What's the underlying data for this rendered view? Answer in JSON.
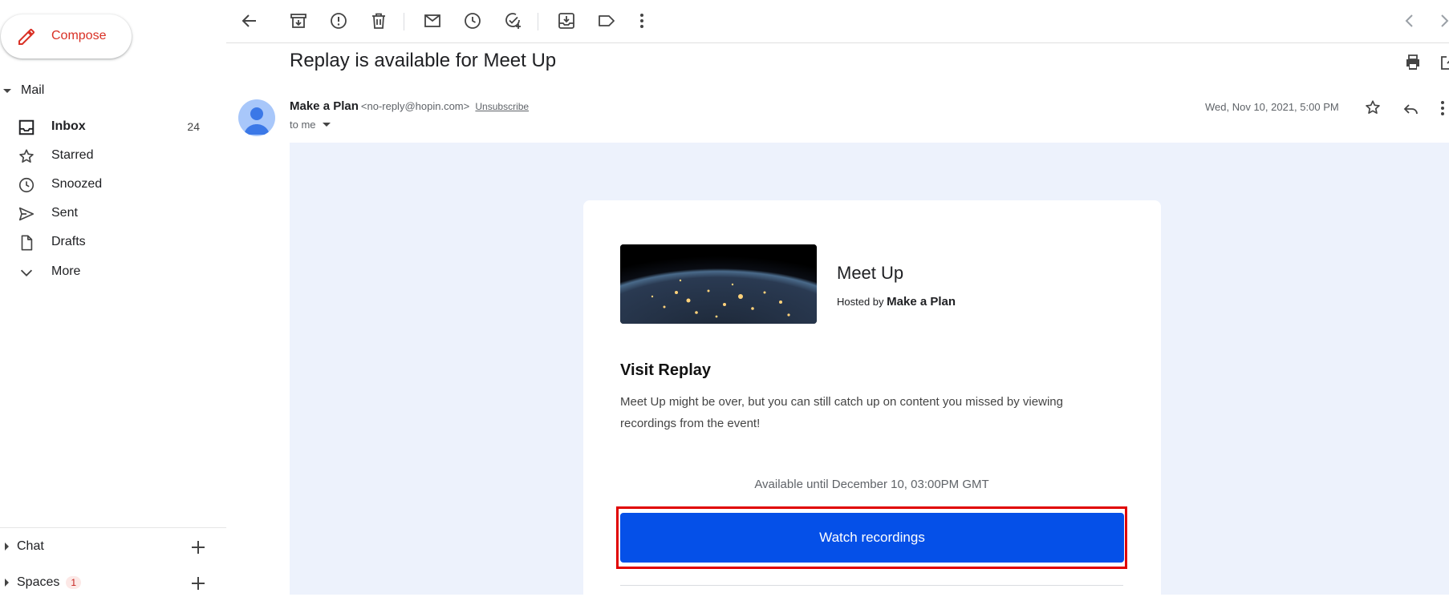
{
  "sidebar": {
    "compose_label": "Compose",
    "mail_section": "Mail",
    "items": [
      {
        "label": "Inbox",
        "count": "24",
        "icon": "inbox-icon"
      },
      {
        "label": "Starred",
        "count": "",
        "icon": "star-icon"
      },
      {
        "label": "Snoozed",
        "count": "",
        "icon": "clock-icon"
      },
      {
        "label": "Sent",
        "count": "",
        "icon": "send-icon"
      },
      {
        "label": "Drafts",
        "count": "",
        "icon": "file-icon"
      },
      {
        "label": "More",
        "count": "",
        "icon": "chevron-down-icon"
      }
    ],
    "chat_section": "Chat",
    "spaces_section": "Spaces",
    "spaces_badge": "1"
  },
  "toolbar": {
    "icons": [
      "back-arrow-icon",
      "archive-icon",
      "report-spam-icon",
      "delete-icon",
      "mark-unread-icon",
      "snooze-icon",
      "add-task-icon",
      "move-to-icon",
      "label-icon",
      "more-vert-icon"
    ]
  },
  "message": {
    "subject": "Replay is available for Meet Up",
    "sender_name": "Make a Plan",
    "sender_email": "<no-reply@hopin.com>",
    "unsubscribe": "Unsubscribe",
    "to": "to me",
    "date": "Wed, Nov 10, 2021, 5:00 PM"
  },
  "email": {
    "event_name": "Meet Up",
    "hosted_prefix": "Hosted by",
    "host": "Make a Plan",
    "replay_title": "Visit Replay",
    "replay_desc": "Meet Up might be over, but you can still catch up on content you missed by viewing recordings from the event!",
    "available": "Available until December 10, 03:00PM GMT",
    "watch_button": "Watch recordings"
  },
  "colors": {
    "compose_text": "#d93025",
    "email_bg": "#edf2fc",
    "watch_button_bg": "#0550e8",
    "highlight_outline": "#e00000"
  }
}
